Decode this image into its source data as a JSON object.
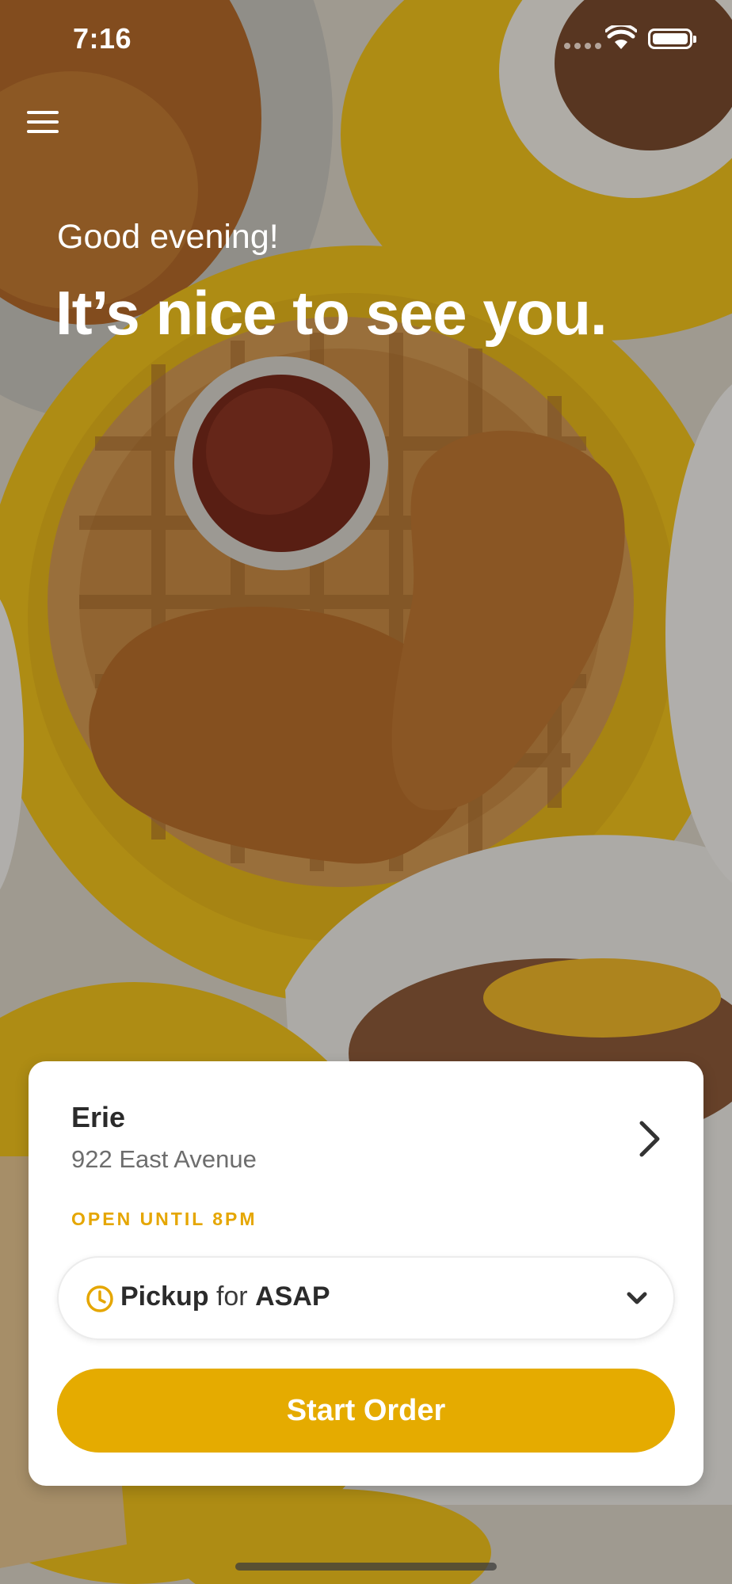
{
  "status_bar": {
    "time": "7:16"
  },
  "menu": {
    "icon": "hamburger-menu-icon"
  },
  "greeting": {
    "salutation": "Good evening!",
    "headline": "It’s nice to see you."
  },
  "location_card": {
    "name": "Erie",
    "address": "922 East Avenue",
    "status": "OPEN UNTIL 8PM",
    "order_type": {
      "mode": "Pickup",
      "connector": "for",
      "time": "ASAP"
    },
    "cta_label": "Start Order"
  },
  "colors": {
    "accent": "#e5ab00",
    "status_text": "#e5a600",
    "plate_yellow": "#f2c21d"
  }
}
